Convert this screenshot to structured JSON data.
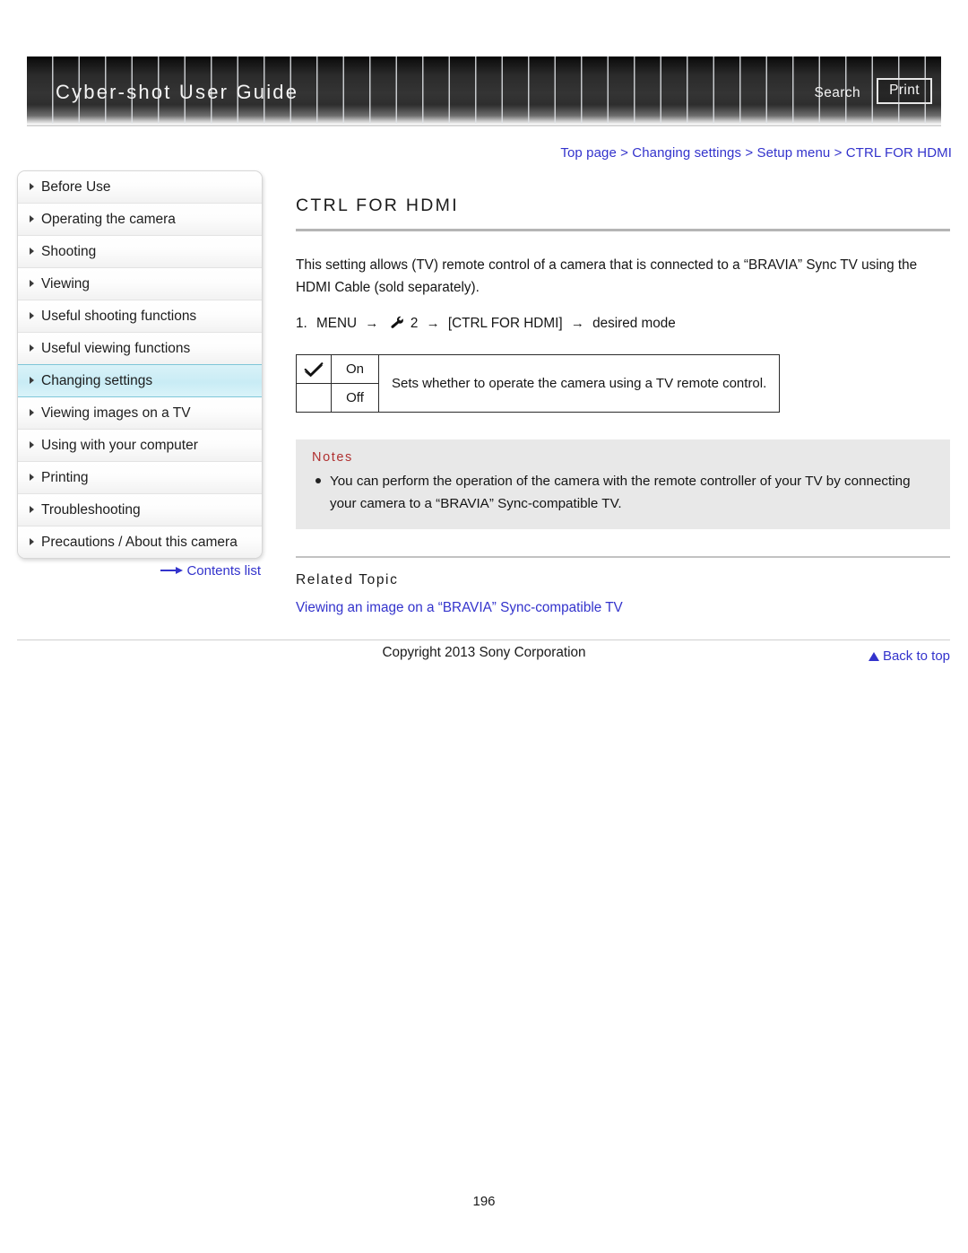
{
  "header": {
    "title": "Cyber-shot User Guide",
    "search_label": "Search",
    "print_label": "Print"
  },
  "breadcrumb": {
    "text": "Top page > Changing settings > Setup menu > CTRL FOR HDMI"
  },
  "sidebar": {
    "items": [
      {
        "label": "Before Use",
        "active": false
      },
      {
        "label": "Operating the camera",
        "active": false
      },
      {
        "label": "Shooting",
        "active": false
      },
      {
        "label": "Viewing",
        "active": false
      },
      {
        "label": "Useful shooting functions",
        "active": false
      },
      {
        "label": "Useful viewing functions",
        "active": false
      },
      {
        "label": "Changing settings",
        "active": true
      },
      {
        "label": "Viewing images on a TV",
        "active": false
      },
      {
        "label": "Using with your computer",
        "active": false
      },
      {
        "label": "Printing",
        "active": false
      },
      {
        "label": "Troubleshooting",
        "active": false
      },
      {
        "label": "Precautions / About this camera",
        "active": false
      }
    ],
    "contents_link": "Contents list"
  },
  "main": {
    "page_title": "CTRL FOR HDMI",
    "intro": "This setting allows (TV) remote control of a camera that is connected to a “BRAVIA” Sync TV using the HDMI Cable (sold separately).",
    "step": {
      "number": "1.",
      "menu_label": "MENU",
      "arrow1": "→",
      "setup_number": "2",
      "arrow2": "→",
      "setting_label": "[CTRL FOR HDMI]",
      "arrow3": "→",
      "result_label": "desired mode"
    },
    "settings_table": {
      "rows": [
        {
          "checked": true,
          "mode": "On"
        },
        {
          "checked": false,
          "mode": "Off"
        }
      ],
      "description": "Sets whether to operate the camera using a TV remote control."
    },
    "notes": {
      "title": "Notes",
      "items": [
        "You can perform the operation of the camera with the remote controller of your TV by connecting your camera to a “BRAVIA” Sync-compatible TV."
      ]
    },
    "related": {
      "title": "Related Topic",
      "links": [
        "Viewing an image on a “BRAVIA” Sync-compatible TV"
      ]
    },
    "back_to_top": "Back to top"
  },
  "footer": {
    "copyright": "Copyright 2013 Sony Corporation",
    "page_number": "196"
  },
  "colors": {
    "link_blue": "#3333cc",
    "notes_red": "#b03030",
    "active_nav": "#c9ecf5"
  }
}
